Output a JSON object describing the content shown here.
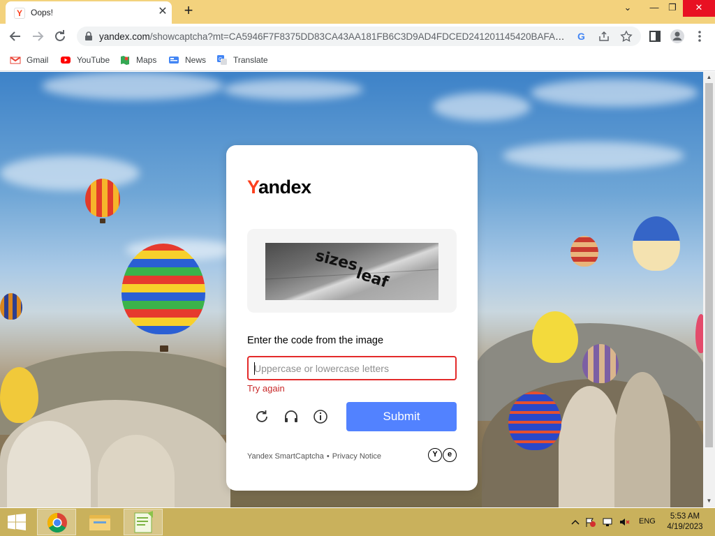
{
  "browser": {
    "tab": {
      "title": "Oops!",
      "favicon": "yandex-y-icon"
    },
    "url": {
      "domain": "yandex.com",
      "path": "/showcaptcha?mt=CA5946F7F8375DD83CA43AA181FB6C3D9AD4FDCED241201145420BAFAB8..."
    },
    "bookmarks": [
      {
        "label": "Gmail",
        "icon": "gmail-icon"
      },
      {
        "label": "YouTube",
        "icon": "youtube-icon"
      },
      {
        "label": "Maps",
        "icon": "maps-icon"
      },
      {
        "label": "News",
        "icon": "news-icon"
      },
      {
        "label": "Translate",
        "icon": "translate-icon"
      }
    ]
  },
  "captcha": {
    "logo_first": "Y",
    "logo_rest": "andex",
    "image_text_1": "sizes",
    "image_text_2": "leaf",
    "label": "Enter the code from the image",
    "input_placeholder": "Uppercase or lowercase letters",
    "error": "Try again",
    "submit": "Submit",
    "footer_left": "Yandex SmartCaptcha",
    "footer_sep": "•",
    "footer_right": "Privacy Notice",
    "footer_mark_1": "Y",
    "footer_mark_2": "e"
  },
  "taskbar": {
    "lang": "ENG",
    "time": "5:53 AM",
    "date": "4/19/2023"
  },
  "colors": {
    "accent": "#5282ff",
    "error": "#e32a2a",
    "brand_red": "#fc3f1d",
    "window_frame": "#f3d27d"
  }
}
